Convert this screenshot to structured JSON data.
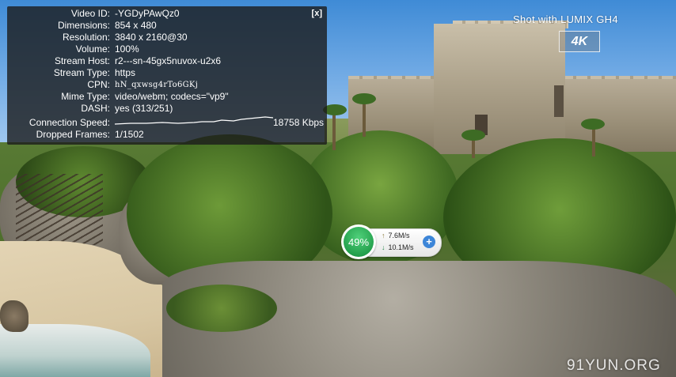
{
  "stats_panel": {
    "close_label": "[x]",
    "rows": [
      {
        "label": "Video ID:",
        "value": "-YGDyPAwQz0"
      },
      {
        "label": "Dimensions:",
        "value": "854 x 480"
      },
      {
        "label": "Resolution:",
        "value": "3840 x 2160@30"
      },
      {
        "label": "Volume:",
        "value": "100%"
      },
      {
        "label": "Stream Host:",
        "value": "r2---sn-45gx5nuvox-u2x6"
      },
      {
        "label": "Stream Type:",
        "value": "https"
      },
      {
        "label": "CPN:",
        "value": "hN_qxwsg4rTo6GKj"
      },
      {
        "label": "Mime Type:",
        "value": "video/webm; codecs=\"vp9\""
      },
      {
        "label": "DASH:",
        "value": "yes (313/251)"
      }
    ],
    "connection_speed_label": "Connection Speed:",
    "connection_speed_value": "18758 Kbps",
    "dropped_frames_label": "Dropped Frames:",
    "dropped_frames_value": "1/1502"
  },
  "brand_text": "Shot with LUMIX GH4",
  "badge_4k": "4K",
  "watermark": "91YUN.ORG",
  "network_widget": {
    "percent": "49%",
    "upload": "7.6M/s",
    "download": "10.1M/s",
    "up_arrow": "↑",
    "down_arrow": "↓",
    "plus": "+"
  },
  "colors": {
    "panel_bg": "#1c1c1c",
    "widget_green": "#2fb55a",
    "widget_plus_blue": "#3d86d8"
  }
}
